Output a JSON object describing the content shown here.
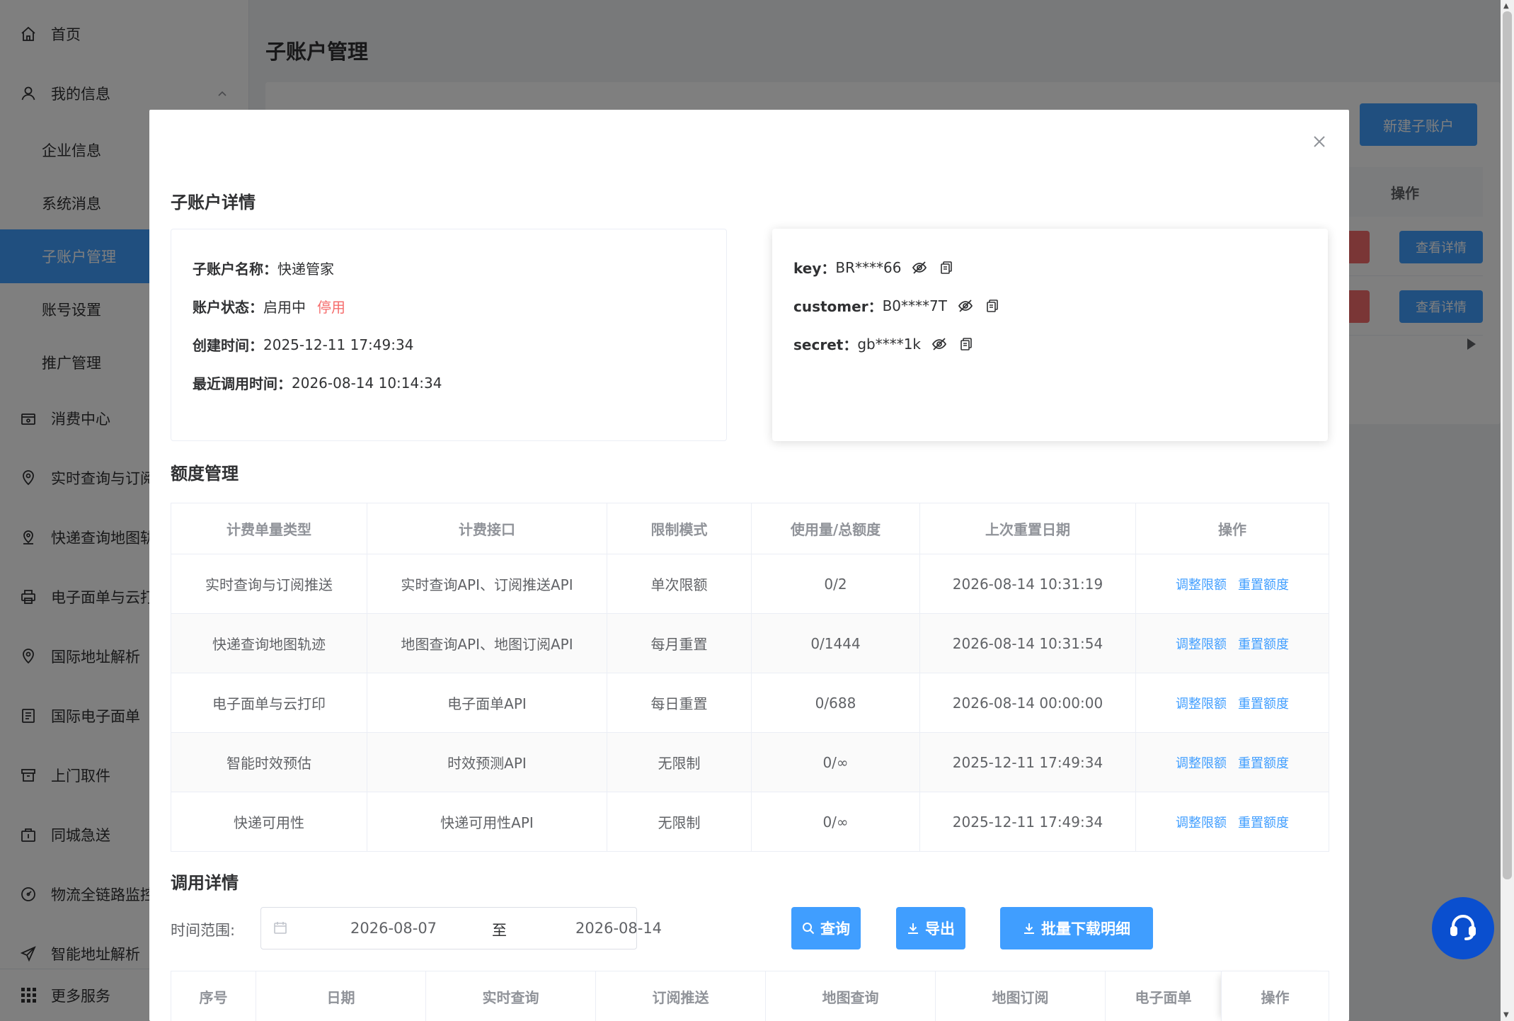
{
  "sidebar": {
    "items": [
      {
        "label": "首页",
        "icon": "home-icon"
      },
      {
        "label": "我的信息",
        "icon": "user-icon"
      },
      {
        "label": "企业信息"
      },
      {
        "label": "系统消息"
      },
      {
        "label": "子账户管理"
      },
      {
        "label": "账号设置"
      },
      {
        "label": "推广管理"
      },
      {
        "label": "消费中心",
        "icon": "wallet-icon"
      },
      {
        "label": "实时查询与订阅",
        "icon": "location-icon"
      },
      {
        "label": "快递查询地图轨",
        "icon": "map-pin-icon"
      },
      {
        "label": "电子面单与云打",
        "icon": "printer-icon"
      },
      {
        "label": "国际地址解析",
        "icon": "location-icon"
      },
      {
        "label": "国际电子面单",
        "icon": "document-icon"
      },
      {
        "label": "上门取件",
        "icon": "box-icon"
      },
      {
        "label": "同城急送",
        "icon": "package-icon"
      },
      {
        "label": "物流全链路监控",
        "icon": "gauge-icon"
      },
      {
        "label": "智能地址解析",
        "icon": "send-icon"
      }
    ],
    "more": "更多服务"
  },
  "page": {
    "title": "子账户管理",
    "new_button": "新建子账户",
    "table_op_header": "操作",
    "detail_button": "查看详情"
  },
  "dialog": {
    "title": "子账户详情",
    "info": {
      "name_label": "子账户名称：",
      "name_value": "快递管家",
      "status_label": "账户状态：",
      "status_value": "启用中",
      "status_action": "停用",
      "created_label": "创建时间：",
      "created_value": "2025-12-11 17:49:34",
      "last_call_label": "最近调用时间：",
      "last_call_value": "2026-08-14 10:14:34"
    },
    "credentials": [
      {
        "label": "key：",
        "value": "BR****66"
      },
      {
        "label": "customer：",
        "value": "B0****7T"
      },
      {
        "label": "secret：",
        "value": "gb****1k"
      }
    ],
    "quota": {
      "title": "额度管理",
      "headers": [
        "计费单量类型",
        "计费接口",
        "限制模式",
        "使用量/总额度",
        "上次重置日期",
        "操作"
      ],
      "rows": [
        [
          "实时查询与订阅推送",
          "实时查询API、订阅推送API",
          "单次限额",
          "0/2",
          "2026-08-14 10:31:19"
        ],
        [
          "快递查询地图轨迹",
          "地图查询API、地图订阅API",
          "每月重置",
          "0/1444",
          "2026-08-14 10:31:54"
        ],
        [
          "电子面单与云打印",
          "电子面单API",
          "每日重置",
          "0/688",
          "2026-08-14 00:00:00"
        ],
        [
          "智能时效预估",
          "时效预测API",
          "无限制",
          "0/∞",
          "2025-12-11 17:49:34"
        ],
        [
          "快递可用性",
          "快递可用性API",
          "无限制",
          "0/∞",
          "2025-12-11 17:49:34"
        ]
      ],
      "adjust_label": "调整限额",
      "reset_label": "重置额度"
    },
    "calls": {
      "title": "调用详情",
      "range_label": "时间范围:",
      "start_date": "2026-08-07",
      "range_sep": "至",
      "end_date": "2026-08-14",
      "query_button": "查询",
      "export_button": "导出",
      "batch_button": "批量下载明细",
      "headers": [
        "序号",
        "日期",
        "实时查询",
        "订阅推送",
        "地图查询",
        "地图订阅",
        "电子面单",
        "操作"
      ]
    }
  },
  "colors": {
    "primary": "#409eff",
    "danger": "#f56c6c",
    "help": "#0a4fcf"
  }
}
